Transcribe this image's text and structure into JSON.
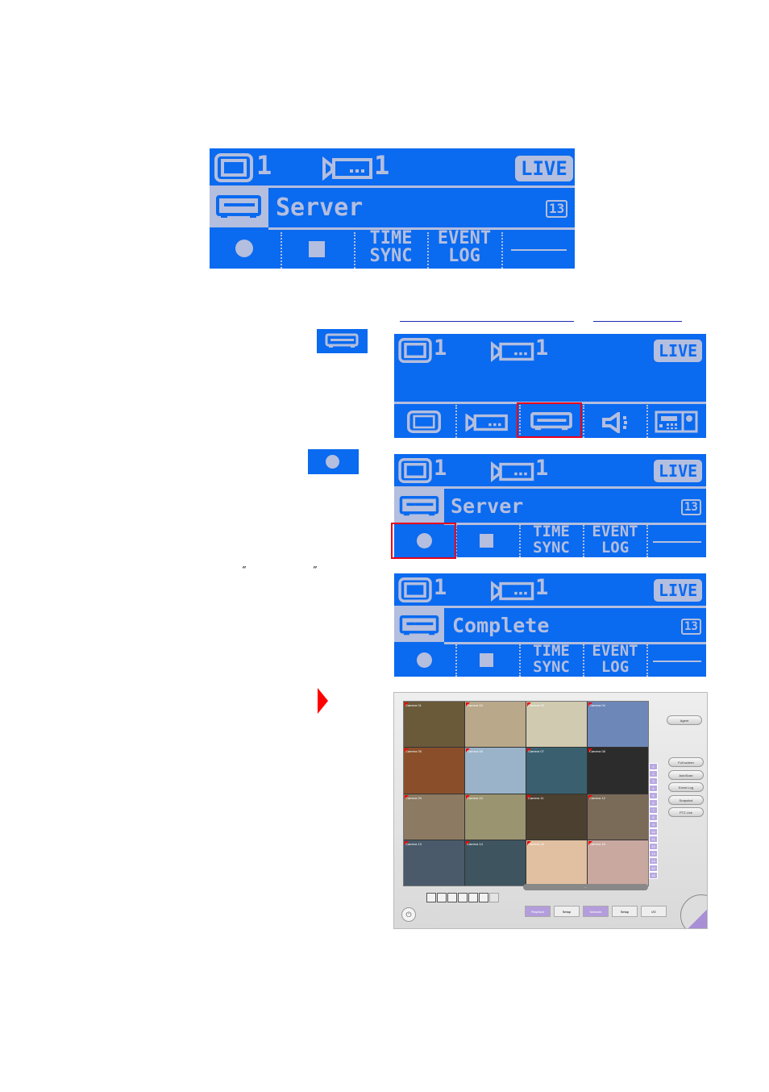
{
  "colors": {
    "lcd_background": "#0a6af0",
    "lcd_foreground": "#b4bede",
    "highlight_box": "#e8001c",
    "arrow": "#ff0000",
    "link_underline": "#1a2ab4"
  },
  "lcd_panels": [
    {
      "id": "server-menu",
      "monitor_count": "1",
      "camera_count": "1",
      "mode": "LIVE",
      "title": "Server",
      "badge": "13",
      "buttons": [
        "record",
        "stop",
        "TIME SYNC",
        "EVENT LOG",
        "blank"
      ],
      "time_sync_lines": [
        "TIME",
        "SYNC"
      ],
      "event_log_lines": [
        "EVENT",
        "LOG"
      ]
    },
    {
      "id": "main-menu",
      "monitor_count": "1",
      "camera_count": "1",
      "mode": "LIVE",
      "buttons": [
        "monitor",
        "camera",
        "server",
        "audio",
        "dvr"
      ],
      "highlighted": "server"
    },
    {
      "id": "server-record",
      "monitor_count": "1",
      "camera_count": "1",
      "mode": "LIVE",
      "title": "Server",
      "badge": "13",
      "time_sync_lines": [
        "TIME",
        "SYNC"
      ],
      "event_log_lines": [
        "EVENT",
        "LOG"
      ],
      "highlighted": "record"
    },
    {
      "id": "server-complete",
      "monitor_count": "1",
      "camera_count": "1",
      "mode": "LIVE",
      "title": "Complete",
      "badge": "13",
      "time_sync_lines": [
        "TIME",
        "SYNC"
      ],
      "event_log_lines": [
        "EVENT",
        "LOG"
      ]
    }
  ],
  "inline_icons": {
    "server_icon": "server-icon",
    "record_icon": "record-icon"
  },
  "quotes": {
    "open": "“",
    "close": "”"
  },
  "software": {
    "cameras": [
      "Camera 01",
      "Camera 02",
      "Camera 03",
      "Camera 04",
      "Camera 05",
      "Camera 06",
      "Camera 07",
      "Camera 08",
      "Camera 09",
      "Camera 10",
      "Camera 11",
      "Camera 12",
      "Camera 13",
      "Camera 14",
      "Camera 15",
      "Camera 16"
    ],
    "agent_button": "Agent",
    "side_buttons": [
      "Full screen",
      "AutoScan",
      "Event Log",
      "Snapshot",
      "PTZ Live"
    ],
    "channel_numbers": [
      "1",
      "2",
      "3",
      "4",
      "5",
      "6",
      "7",
      "8",
      "9",
      "10",
      "11",
      "12",
      "13",
      "14",
      "15",
      "16"
    ],
    "bottom_tabs": [
      "Playback",
      "Setup",
      "Network",
      "Setup",
      "I/O"
    ],
    "status_text": "..."
  }
}
